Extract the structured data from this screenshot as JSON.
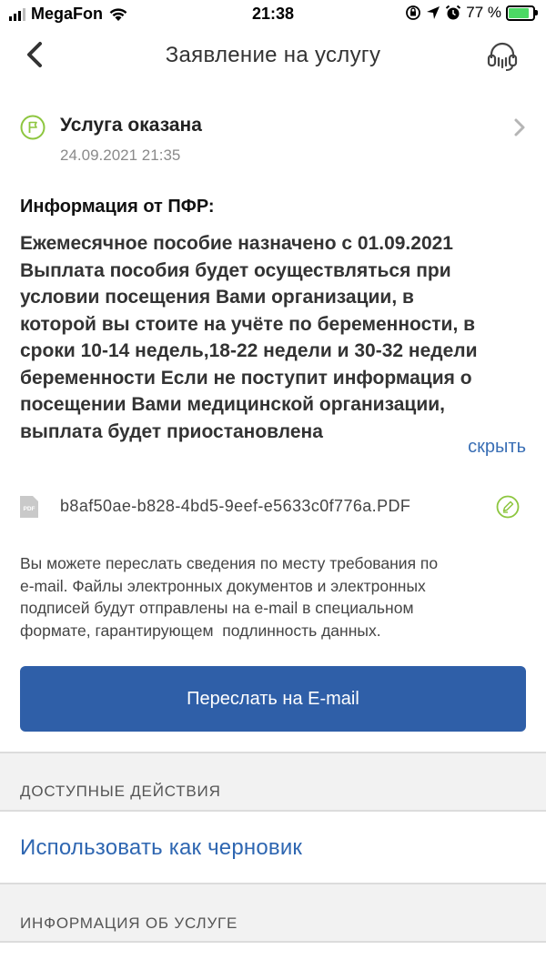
{
  "status_bar": {
    "carrier": "MegaFon",
    "time": "21:38",
    "battery": "77 %",
    "battery_level_percent": 77
  },
  "header": {
    "title": "Заявление на услугу",
    "back_icon": "chevron-left-icon",
    "support_icon": "headset-icon"
  },
  "status": {
    "title": "Услуга оказана",
    "date": "24.09.2021 21:35",
    "icon": "flag-icon",
    "accent_color": "#8dc63f"
  },
  "info": {
    "heading": "Информация от ПФР:",
    "lines": [
      "Ежемесячное пособие назначено с 01.09.2021",
      "Выплата пособия будет осуществляться при",
      "условии посещения Вами организации, в",
      "которой вы стоите на учёте по беременности, в",
      "сроки 10-14 недель,18-22 недели и 30-32 недели",
      "беременности Если не поступит информация о",
      "посещении Вами медицинской организации,",
      "выплата будет приостановлена"
    ],
    "hide_label": "скрыть"
  },
  "attachment": {
    "badge": "PDF",
    "file_name": "b8af50ae-b828-4bd5-9eef-e5633c0f776a.PDF",
    "sign_icon": "signature-icon"
  },
  "note": {
    "lines": [
      "Вы можете переслать сведения по месту требования по",
      "e-mail. Файлы электронных документов и электронных",
      "подписей будут отправлены на e-mail в специальном",
      "формате, гарантирующем  подлинность данных."
    ]
  },
  "send_button": {
    "label": "Переслать на E-mail",
    "color": "#2f5fa8"
  },
  "sections": {
    "actions_label": "ДОСТУПНЫЕ ДЕЙСТВИЯ",
    "use_as_draft": "Использовать как черновик",
    "service_info_label": "ИНФОРМАЦИЯ ОБ УСЛУГЕ"
  }
}
